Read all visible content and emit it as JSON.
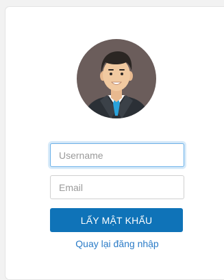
{
  "form": {
    "avatar_icon": "user-avatar-icon",
    "username": {
      "value": "",
      "placeholder": "Username",
      "focused": true
    },
    "email": {
      "value": "",
      "placeholder": "Email"
    },
    "submit_label": "LẤY MẬT KHẨU",
    "back_link_label": "Quay lại đăng nhập"
  },
  "colors": {
    "primary_button": "#0f73b8",
    "link": "#2a7bc7",
    "focus_border": "#66afe9"
  }
}
